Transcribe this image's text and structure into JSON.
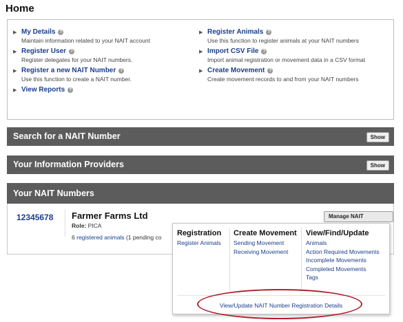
{
  "page": {
    "title": "Home"
  },
  "quick_links": {
    "left": [
      {
        "label": "My Details",
        "desc": "Maintain information related to your NAIT account"
      },
      {
        "label": "Register User",
        "desc": "Register delegates for your NAIT numbers."
      },
      {
        "label": "Register a new NAIT Number",
        "desc": "Use this function to create a NAIT number."
      },
      {
        "label": "View Reports",
        "desc": ""
      }
    ],
    "right": [
      {
        "label": "Register Animals",
        "desc": "Use this function to register animals at your NAIT numbers"
      },
      {
        "label": "Import CSV File",
        "desc": "Import animal registration or movement data in a CSV format"
      },
      {
        "label": "Create Movement",
        "desc": "Create movement records to and from your NAIT numbers"
      }
    ]
  },
  "sections": {
    "search": {
      "title": "Search for a NAIT Number",
      "button": "Show"
    },
    "providers": {
      "title": "Your Information Providers",
      "button": "Show"
    },
    "numbers": {
      "title": "Your NAIT Numbers"
    }
  },
  "nait_entry": {
    "number": "12345678",
    "name": "Farmer Farms Ltd",
    "role_label": "Role:",
    "role_value": "PICA",
    "animals_count": "6",
    "animals_link": "registered animals",
    "animals_suffix": "(1 pending co",
    "manage_button": "Manage NAIT Activities"
  },
  "dropdown": {
    "registration": {
      "heading": "Registration",
      "links": [
        "Register Animals"
      ]
    },
    "create_movement": {
      "heading": "Create Movement",
      "links": [
        "Sending Movement",
        "Receiving Movement"
      ]
    },
    "view_find_update": {
      "heading": "View/Find/Update",
      "links": [
        "Animals",
        "Action Required Movements",
        "Incomplete Movements",
        "Completed Movements",
        "Tags"
      ]
    },
    "footer_link": "View/Update NAIT Number Registration Details"
  },
  "colors": {
    "link": "#1a3e8c",
    "bar": "#5c5c5c",
    "highlight": "#b0202a"
  },
  "icons": {
    "help": "help-icon",
    "arrow": "arrow-right-icon"
  }
}
